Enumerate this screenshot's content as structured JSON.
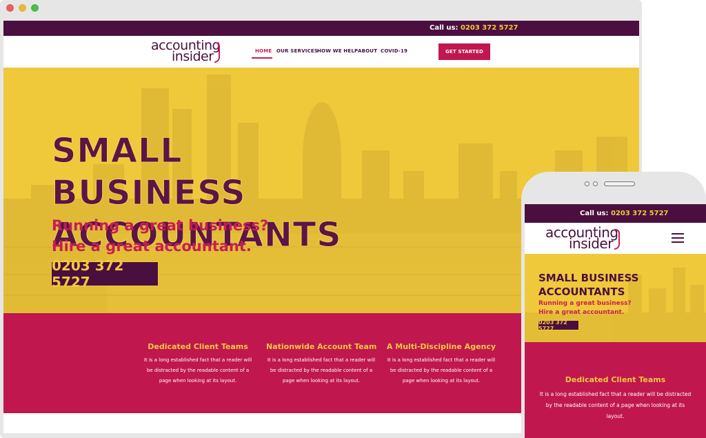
{
  "topbar": {
    "call_label": "Call us: ",
    "phone": "0203 372 5727"
  },
  "logo": {
    "line1": "accounting",
    "line2": "insider"
  },
  "nav": {
    "items": [
      "HOME",
      "OUR SERVICES",
      "HOW WE HELP",
      "ABOUT",
      "COVID-19"
    ],
    "active_index": 0,
    "cta": "GET STARTED"
  },
  "hero": {
    "headline_line1": "SMALL BUSINESS",
    "headline_line2": "ACCOUNTANTS",
    "sub_line1": "Running a great business?",
    "sub_line2": "Hire a great accountant.",
    "phone": "0203 372 5727"
  },
  "features": [
    {
      "title": "Dedicated Client Teams",
      "text": "It is a long established fact that a reader will be distracted by the readable content of a page when looking at its layout."
    },
    {
      "title": "Nationwide Account Team",
      "text": "It is a long established fact that a reader will be distracted by the readable content of a page when looking at its layout."
    },
    {
      "title": "A Multi-Discipline Agency",
      "text": "It is a long established fact that a reader will be distracted by the readable content of a page when looking at its layout."
    }
  ],
  "mobile": {
    "call_label": "Call us: ",
    "phone": "0203 372 5727",
    "headline_line1": "SMALL BUSINESS",
    "headline_line2": "ACCOUNTANTS",
    "sub_line1": "Running a great business?",
    "sub_line2": "Hire a great accountant.",
    "hero_phone": "0203 372 5727",
    "feature_title": "Dedicated Client Teams",
    "feature_text": "It is a long established fact that a reader will be distracted by the readable content of a page when looking at its layout."
  },
  "colors": {
    "brand_purple": "#4a0f3e",
    "brand_magenta": "#c0174f",
    "brand_yellow": "#efc93a",
    "accent_gold": "#f3c93c"
  }
}
